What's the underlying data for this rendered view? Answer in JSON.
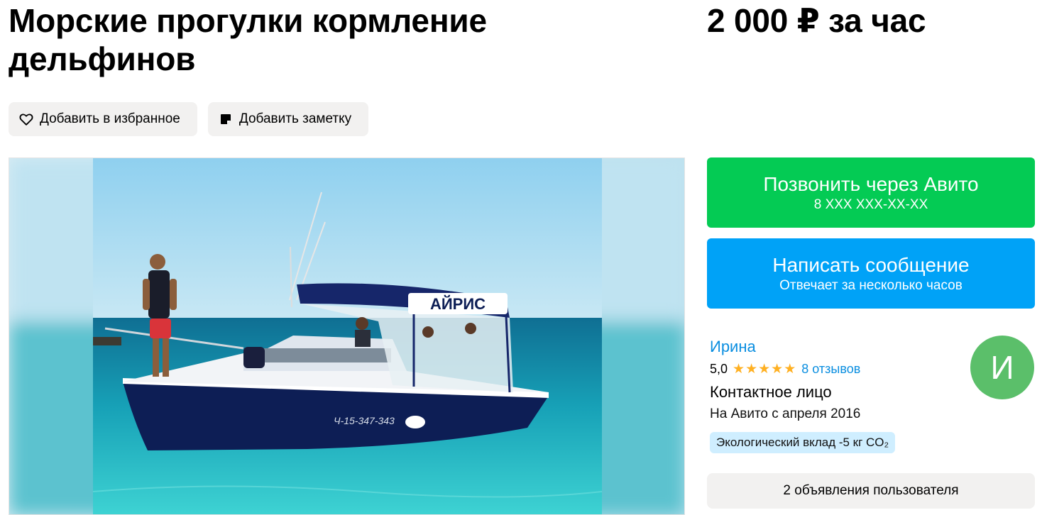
{
  "listing": {
    "title": "Морские прогулки кормление дельфинов",
    "price": "2 000 ₽ за час"
  },
  "actions": {
    "favorite_label": "Добавить в избранное",
    "favorite_icon": "heart-icon",
    "note_label": "Добавить заметку",
    "note_icon": "note-icon"
  },
  "photo": {
    "boat_name": "АЙРИС",
    "boat_number": "Ч-15-347-343"
  },
  "contact": {
    "call_label": "Позвонить через Авито",
    "call_phone": "8 XXX XXX-XX-XX",
    "call_color": "#04cb54",
    "message_label": "Написать сообщение",
    "message_sub": "Отвечает за несколько часов",
    "message_color": "#00a2f7"
  },
  "seller": {
    "name": "Ирина",
    "rating": "5,0",
    "stars": 5,
    "reviews": "8 отзывов",
    "type": "Контактное лицо",
    "since": "На Авито с апреля 2016",
    "eco": "Экологический вклад -5 кг CO₂",
    "avatar_letter": "И",
    "avatar_color": "#5bbf6a",
    "listings": "2 объявления пользователя"
  }
}
